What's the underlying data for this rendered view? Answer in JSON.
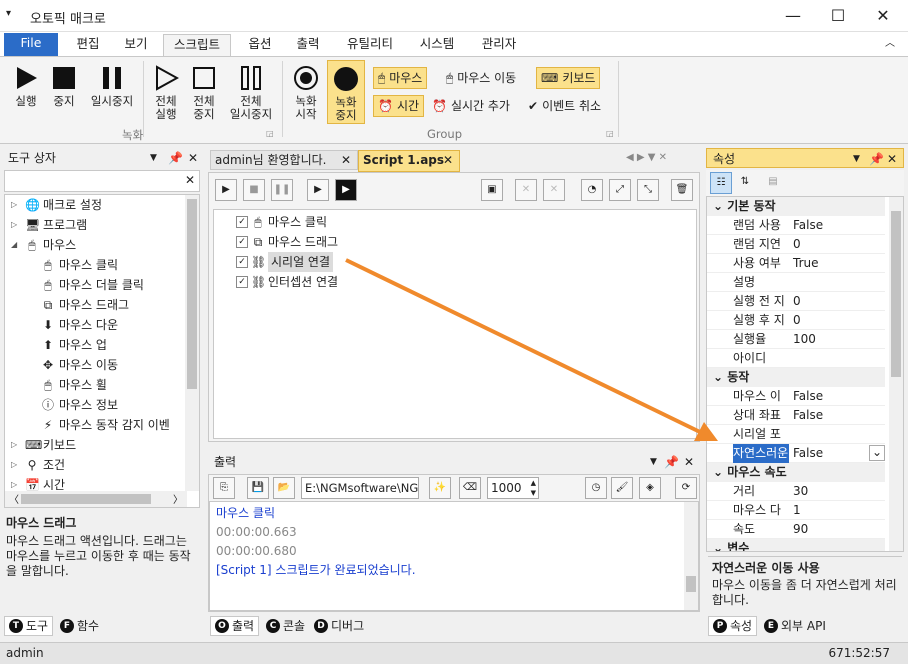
{
  "app": {
    "title": "오토픽 매크로"
  },
  "menu_tabs": [
    "File",
    "편집",
    "보기",
    "스크립트",
    "옵션",
    "출력",
    "유틸리티",
    "시스템",
    "관리자"
  ],
  "ribbon": {
    "record_group": {
      "label": "녹화",
      "buttons": [
        {
          "l1": "실행",
          "l2": ""
        },
        {
          "l1": "중지",
          "l2": ""
        },
        {
          "l1": "일시중지",
          "l2": ""
        },
        {
          "l1": "전체",
          "l2": "실행"
        },
        {
          "l1": "전체",
          "l2": "중지"
        },
        {
          "l1": "전체",
          "l2": "일시중지"
        }
      ]
    },
    "group2": {
      "label": "Group",
      "rec_start": {
        "l1": "녹화",
        "l2": "시작"
      },
      "rec_stop": {
        "l1": "녹화",
        "l2": "중지"
      },
      "mouse": "마우스",
      "mouse_move": "마우스 이동",
      "keyboard": "키보드",
      "time": "시간",
      "realtime_add": "실시간 추가",
      "event_cancel": "이벤트 취소"
    }
  },
  "toolbox": {
    "title": "도구 상자",
    "items": [
      {
        "label": "매크로 설정",
        "icon": "globe-icon",
        "level": 0,
        "exp": "▷"
      },
      {
        "label": "프로그램",
        "icon": "monitor-icon",
        "level": 0,
        "exp": "▷"
      },
      {
        "label": "마우스",
        "icon": "mouse-icon",
        "level": 0,
        "exp": "◢"
      },
      {
        "label": "마우스 클릭",
        "icon": "mouse-click-icon",
        "level": 1,
        "exp": ""
      },
      {
        "label": "마우스 더블 클릭",
        "icon": "mouse-double-click-icon",
        "level": 1,
        "exp": ""
      },
      {
        "label": "마우스 드래그",
        "icon": "mouse-drag-icon",
        "level": 1,
        "exp": ""
      },
      {
        "label": "마우스 다운",
        "icon": "mouse-down-icon",
        "level": 1,
        "exp": ""
      },
      {
        "label": "마우스 업",
        "icon": "mouse-up-icon",
        "level": 1,
        "exp": ""
      },
      {
        "label": "마우스 이동",
        "icon": "move-icon",
        "level": 1,
        "exp": ""
      },
      {
        "label": "마우스 휠",
        "icon": "mouse-wheel-icon",
        "level": 1,
        "exp": ""
      },
      {
        "label": "마우스 정보",
        "icon": "info-icon",
        "level": 1,
        "exp": ""
      },
      {
        "label": "마우스 동작 감지 이벤",
        "icon": "lightning-icon",
        "level": 1,
        "exp": ""
      },
      {
        "label": "키보드",
        "icon": "keyboard-icon",
        "level": 0,
        "exp": "▷"
      },
      {
        "label": "조건",
        "icon": "condition-icon",
        "level": 0,
        "exp": "▷"
      },
      {
        "label": "시간",
        "icon": "calendar-icon",
        "level": 0,
        "exp": "▷"
      }
    ],
    "desc_title": "마우스 드래그",
    "desc_text": "마우스 드래그 액션입니다. 드래그는 마우스를 누르고 이동한 후 때는 동작을 말합니다.",
    "bottom_tabs": [
      "도구",
      "함수"
    ]
  },
  "editor": {
    "tabs": [
      "admin님 환영합니다.",
      "Script 1.aps"
    ],
    "lines": [
      "마우스 클릭",
      "마우스 드래그",
      "시리얼 연결",
      "인터셉션 연결"
    ]
  },
  "output": {
    "title": "출력",
    "path": "E:\\NGMsoftware\\NG",
    "interval": "1000",
    "lines": [
      {
        "text": "마우스 클릭",
        "color": "#1a3fcf"
      },
      {
        "text": "00:00:00.663",
        "color": "#888888"
      },
      {
        "text": "00:00:00.680",
        "color": "#888888"
      },
      {
        "text": "[Script 1] 스크립트가 완료되었습니다.",
        "color": "#1a3fcf"
      }
    ],
    "bottom_tabs": [
      "출력",
      "콘솔",
      "디버그"
    ]
  },
  "properties": {
    "title": "속성",
    "cat1": "기본 동작",
    "rows1": [
      {
        "n": "랜덤 사용",
        "v": "False"
      },
      {
        "n": "랜덤 지연",
        "v": "0"
      },
      {
        "n": "사용 여부",
        "v": "True"
      },
      {
        "n": "설명",
        "v": ""
      },
      {
        "n": "실행 전 지",
        "v": "0"
      },
      {
        "n": "실행 후 지",
        "v": "0"
      },
      {
        "n": "실행율",
        "v": "100"
      },
      {
        "n": "아이디",
        "v": ""
      }
    ],
    "cat2": "동작",
    "rows2": [
      {
        "n": "마우스 이",
        "v": "False"
      },
      {
        "n": "상대 좌표",
        "v": "False"
      },
      {
        "n": "시리얼 포",
        "v": ""
      },
      {
        "n": "자연스러운",
        "v": "False"
      }
    ],
    "cat3": "마우스 속도",
    "rows3": [
      {
        "n": "거리",
        "v": "30"
      },
      {
        "n": "마우스 다",
        "v": "1"
      },
      {
        "n": "속도",
        "v": "90"
      }
    ],
    "cat4": "변수",
    "desc_title": "자연스러운 이동 사용",
    "desc_text": "마우스 이동을 좀 더 자연스럽게 처리합니다.",
    "bottom_tabs": [
      "속성",
      "외부 API"
    ]
  },
  "status": {
    "user": "admin",
    "coords": "671:52:57"
  },
  "colors": {
    "accent": "#2b6cc8",
    "highlight": "#fbe18c",
    "arrow": "#f08a2c"
  }
}
